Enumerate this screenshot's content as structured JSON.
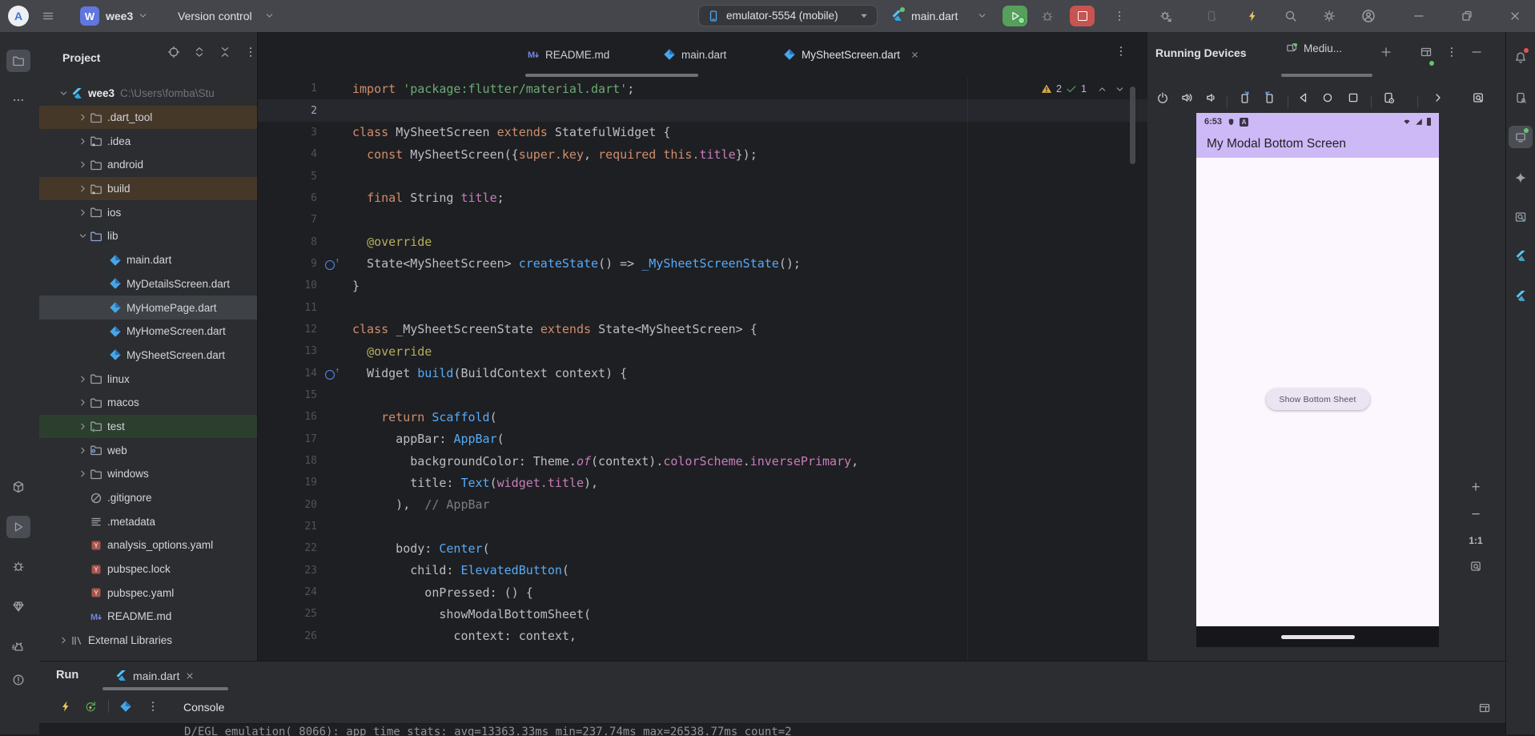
{
  "colors": {
    "run_green": "#57A05C",
    "stop_red": "#C75450",
    "appbar_purple": "#CDB9F6",
    "bolt_yellow": "#F2C55C",
    "warning_yellow": "#D8A74A",
    "ok_green": "#57A25C"
  },
  "titlebar": {
    "project": "wee3",
    "vcs_widget": "Version control",
    "device_selector": "emulator-5554 (mobile)",
    "run_config": "main.dart"
  },
  "left_strip": {
    "items": [
      "project",
      "more-tools",
      "pub-package",
      "run",
      "debug",
      "app-quality-insights",
      "logcat",
      "problems"
    ]
  },
  "right_strip": {
    "items": [
      "notifications",
      "device-manager",
      "running-devices",
      "gemini",
      "flutter-inspector",
      "flutter-performance",
      "flutter-outline"
    ]
  },
  "project": {
    "header": {
      "title": "Project",
      "icons": [
        "select-opened-file",
        "expand-all",
        "collapse-all",
        "options",
        "hide"
      ]
    },
    "root_path": "C:\\Users\\fomba\\Stu",
    "tree": [
      {
        "l": "wee3",
        "ic": "flutter",
        "lvl": 0,
        "chev": "d",
        "suffix": "C:\\Users\\fomba\\Stu"
      },
      {
        "l": ".dart_tool",
        "ic": "folder",
        "lvl": 1,
        "chev": "r",
        "hl": "excl"
      },
      {
        "l": ".idea",
        "ic": "folder-star",
        "lvl": 1,
        "chev": "r"
      },
      {
        "l": "android",
        "ic": "folder",
        "lvl": 1,
        "chev": "r"
      },
      {
        "l": "build",
        "ic": "folder-star",
        "lvl": 1,
        "chev": "r",
        "hl": "excl"
      },
      {
        "l": "ios",
        "ic": "folder",
        "lvl": 1,
        "chev": "r"
      },
      {
        "l": "lib",
        "ic": "folder-lib",
        "lvl": 1,
        "chev": "d"
      },
      {
        "l": "main.dart",
        "ic": "dart",
        "lvl": 2
      },
      {
        "l": "MyDetailsScreen.dart",
        "ic": "dart",
        "lvl": 2
      },
      {
        "l": "MyHomePage.dart",
        "ic": "dart",
        "lvl": 2,
        "hl": "sel"
      },
      {
        "l": "MyHomeScreen.dart",
        "ic": "dart",
        "lvl": 2
      },
      {
        "l": "MySheetScreen.dart",
        "ic": "dart",
        "lvl": 2
      },
      {
        "l": "linux",
        "ic": "folder",
        "lvl": 1,
        "chev": "r"
      },
      {
        "l": "macos",
        "ic": "folder",
        "lvl": 1,
        "chev": "r"
      },
      {
        "l": "test",
        "ic": "folder-test",
        "lvl": 1,
        "chev": "r",
        "hl": "test"
      },
      {
        "l": "web",
        "ic": "folder-web",
        "lvl": 1,
        "chev": "r"
      },
      {
        "l": "windows",
        "ic": "folder",
        "lvl": 1,
        "chev": "r"
      },
      {
        "l": ".gitignore",
        "ic": "ignore",
        "lvl": 1
      },
      {
        "l": ".metadata",
        "ic": "metadata",
        "lvl": 1
      },
      {
        "l": "analysis_options.yaml",
        "ic": "yaml",
        "lvl": 1
      },
      {
        "l": "pubspec.lock",
        "ic": "yaml",
        "lvl": 1
      },
      {
        "l": "pubspec.yaml",
        "ic": "yaml",
        "lvl": 1
      },
      {
        "l": "README.md",
        "ic": "md",
        "lvl": 1
      },
      {
        "l": "External Libraries",
        "ic": "extlib",
        "lvl": 0,
        "chev": "r"
      }
    ]
  },
  "editor": {
    "tabs": [
      {
        "label": "README.md",
        "icon": "md",
        "active": false
      },
      {
        "label": "main.dart",
        "icon": "dart",
        "active": false
      },
      {
        "label": "MySheetScreen.dart",
        "icon": "dart",
        "active": true,
        "closable": true
      }
    ],
    "inspections": {
      "warnings": "2",
      "passed": "1"
    },
    "code": [
      {
        "n": 1,
        "s": [
          [
            "kw",
            "import "
          ],
          [
            "str",
            "'package:flutter/material.dart'"
          ],
          [
            "pl",
            ";"
          ]
        ]
      },
      {
        "n": 2,
        "s": []
      },
      {
        "n": 3,
        "s": [
          [
            "kw",
            "class "
          ],
          [
            "pl",
            "MySheetScreen "
          ],
          [
            "kw",
            "extends "
          ],
          [
            "pl",
            "StatefulWidget {"
          ]
        ]
      },
      {
        "n": 4,
        "s": [
          [
            "pl",
            "  "
          ],
          [
            "kw",
            "const "
          ],
          [
            "pl",
            "MySheetScreen({"
          ],
          [
            "kw",
            "super.key"
          ],
          [
            "pl",
            ", "
          ],
          [
            "kw",
            "required "
          ],
          [
            "kw",
            "this"
          ],
          [
            "fld",
            ".title"
          ],
          [
            "pl",
            "});"
          ]
        ]
      },
      {
        "n": 5,
        "s": []
      },
      {
        "n": 6,
        "s": [
          [
            "pl",
            "  "
          ],
          [
            "kw",
            "final "
          ],
          [
            "pl",
            "String "
          ],
          [
            "fld",
            "title"
          ],
          [
            "pl",
            ";"
          ]
        ]
      },
      {
        "n": 7,
        "s": []
      },
      {
        "n": 8,
        "s": [
          [
            "pl",
            "  "
          ],
          [
            "ann",
            "@override"
          ]
        ]
      },
      {
        "n": 9,
        "ov": true,
        "s": [
          [
            "pl",
            "  State<MySheetScreen> "
          ],
          [
            "fn",
            "createState"
          ],
          [
            "pl",
            "() => "
          ],
          [
            "fn",
            "_MySheetScreenState"
          ],
          [
            "pl",
            "();"
          ]
        ]
      },
      {
        "n": 10,
        "s": [
          [
            "pl",
            "}"
          ]
        ]
      },
      {
        "n": 11,
        "s": []
      },
      {
        "n": 12,
        "s": [
          [
            "kw",
            "class "
          ],
          [
            "pl",
            "_MySheetScreenState "
          ],
          [
            "kw",
            "extends "
          ],
          [
            "pl",
            "State<MySheetScreen> {"
          ]
        ]
      },
      {
        "n": 13,
        "s": [
          [
            "pl",
            "  "
          ],
          [
            "ann",
            "@override"
          ]
        ]
      },
      {
        "n": 14,
        "ov": true,
        "s": [
          [
            "pl",
            "  Widget "
          ],
          [
            "fn",
            "build"
          ],
          [
            "pl",
            "(BuildContext context) {"
          ]
        ]
      },
      {
        "n": 15,
        "s": []
      },
      {
        "n": 16,
        "s": [
          [
            "pl",
            "    "
          ],
          [
            "kw",
            "return "
          ],
          [
            "fn",
            "Scaffold"
          ],
          [
            "pl",
            "("
          ]
        ]
      },
      {
        "n": 17,
        "s": [
          [
            "pl",
            "      appBar: "
          ],
          [
            "fn",
            "AppBar"
          ],
          [
            "pl",
            "("
          ]
        ]
      },
      {
        "n": 18,
        "s": [
          [
            "pl",
            "        backgroundColor: Theme."
          ],
          [
            "itf",
            "of"
          ],
          [
            "pl",
            "(context)."
          ],
          [
            "fld",
            "colorScheme"
          ],
          [
            "pl",
            "."
          ],
          [
            "fld",
            "inversePrimary"
          ],
          [
            "pl",
            ","
          ]
        ]
      },
      {
        "n": 19,
        "s": [
          [
            "pl",
            "        title: "
          ],
          [
            "fn",
            "Text"
          ],
          [
            "pl",
            "("
          ],
          [
            "fld",
            "widget.title"
          ],
          [
            "pl",
            "),"
          ]
        ]
      },
      {
        "n": 20,
        "s": [
          [
            "pl",
            "      ),  "
          ],
          [
            "cm",
            "// AppBar"
          ]
        ]
      },
      {
        "n": 21,
        "s": []
      },
      {
        "n": 22,
        "s": [
          [
            "pl",
            "      body: "
          ],
          [
            "fn",
            "Center"
          ],
          [
            "pl",
            "("
          ]
        ]
      },
      {
        "n": 23,
        "s": [
          [
            "pl",
            "        child: "
          ],
          [
            "fn",
            "ElevatedButton"
          ],
          [
            "pl",
            "("
          ]
        ]
      },
      {
        "n": 24,
        "s": [
          [
            "pl",
            "          onPressed: () {"
          ]
        ]
      },
      {
        "n": 25,
        "s": [
          [
            "pl",
            "            showModalBottomSheet("
          ]
        ]
      },
      {
        "n": 26,
        "s": [
          [
            "pl",
            "              context: context,"
          ]
        ]
      }
    ]
  },
  "devices": {
    "title": "Running Devices",
    "device_tab_label": "Mediu...",
    "toolbar": [
      "power",
      "volume-up",
      "volume-down",
      "rotate-left",
      "rotate-right",
      "nav-back",
      "nav-home",
      "nav-overview",
      "device-settings",
      "more",
      "screenshot"
    ],
    "emulator": {
      "status_time": "6:53",
      "app_bar_title": "My Modal Bottom Screen",
      "button_label": "Show Bottom Sheet"
    },
    "zoom_controls": {
      "zoom_in": "+",
      "zoom_out": "−",
      "reset": "1:1"
    }
  },
  "run_panel": {
    "title": "Run",
    "tab_label": "main.dart",
    "console_label": "Console",
    "console_line": "D/EGL_emulation( 8066): app_time_stats: avg=13363.33ms min=237.74ms max=26538.77ms count=2"
  }
}
